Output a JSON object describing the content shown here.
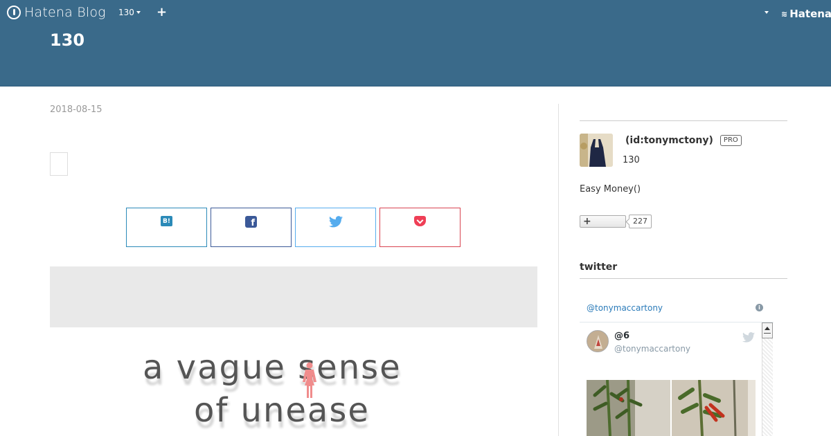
{
  "globalbar": {
    "logo_text": "Hatena Blog",
    "blog_selector": "130",
    "add_label": "+",
    "right_brand": "Hatena"
  },
  "header": {
    "blog_title": "130"
  },
  "entry": {
    "date": "2018-08-15",
    "share_buttons": [
      {
        "name": "hatena-bookmark",
        "glyph": "B!"
      },
      {
        "name": "facebook",
        "glyph": "f"
      },
      {
        "name": "twitter",
        "glyph": ""
      },
      {
        "name": "pocket",
        "glyph": ""
      }
    ],
    "hero_line1": "a vague sense",
    "hero_line2": "of unease"
  },
  "sidebar": {
    "profile_name": "(id:tonymctony)",
    "pro_badge": "PRO",
    "profile_blog": "130",
    "description": "Easy Money()",
    "subscribe_plus": "+",
    "subscriber_count": "227",
    "twitter_heading": "twitter"
  },
  "twitter_widget": {
    "handle": "@tonymaccartony",
    "info": "i",
    "tweet_name": "@6",
    "tweet_handle": "@tonymaccartony"
  },
  "colors": {
    "header_bg": "#3a6a8a",
    "hatena_blue": "#2b8ab8",
    "facebook": "#3b5998",
    "twitter": "#55acee",
    "pocket": "#d94350",
    "hero_accent": "#f08c8c"
  },
  "icons": [
    "hatena-blog-logo-icon",
    "caret-down-icon",
    "plus-icon",
    "hatena-bookmark-icon",
    "facebook-icon",
    "twitter-bird-icon",
    "pocket-icon",
    "person-icon",
    "info-icon"
  ]
}
